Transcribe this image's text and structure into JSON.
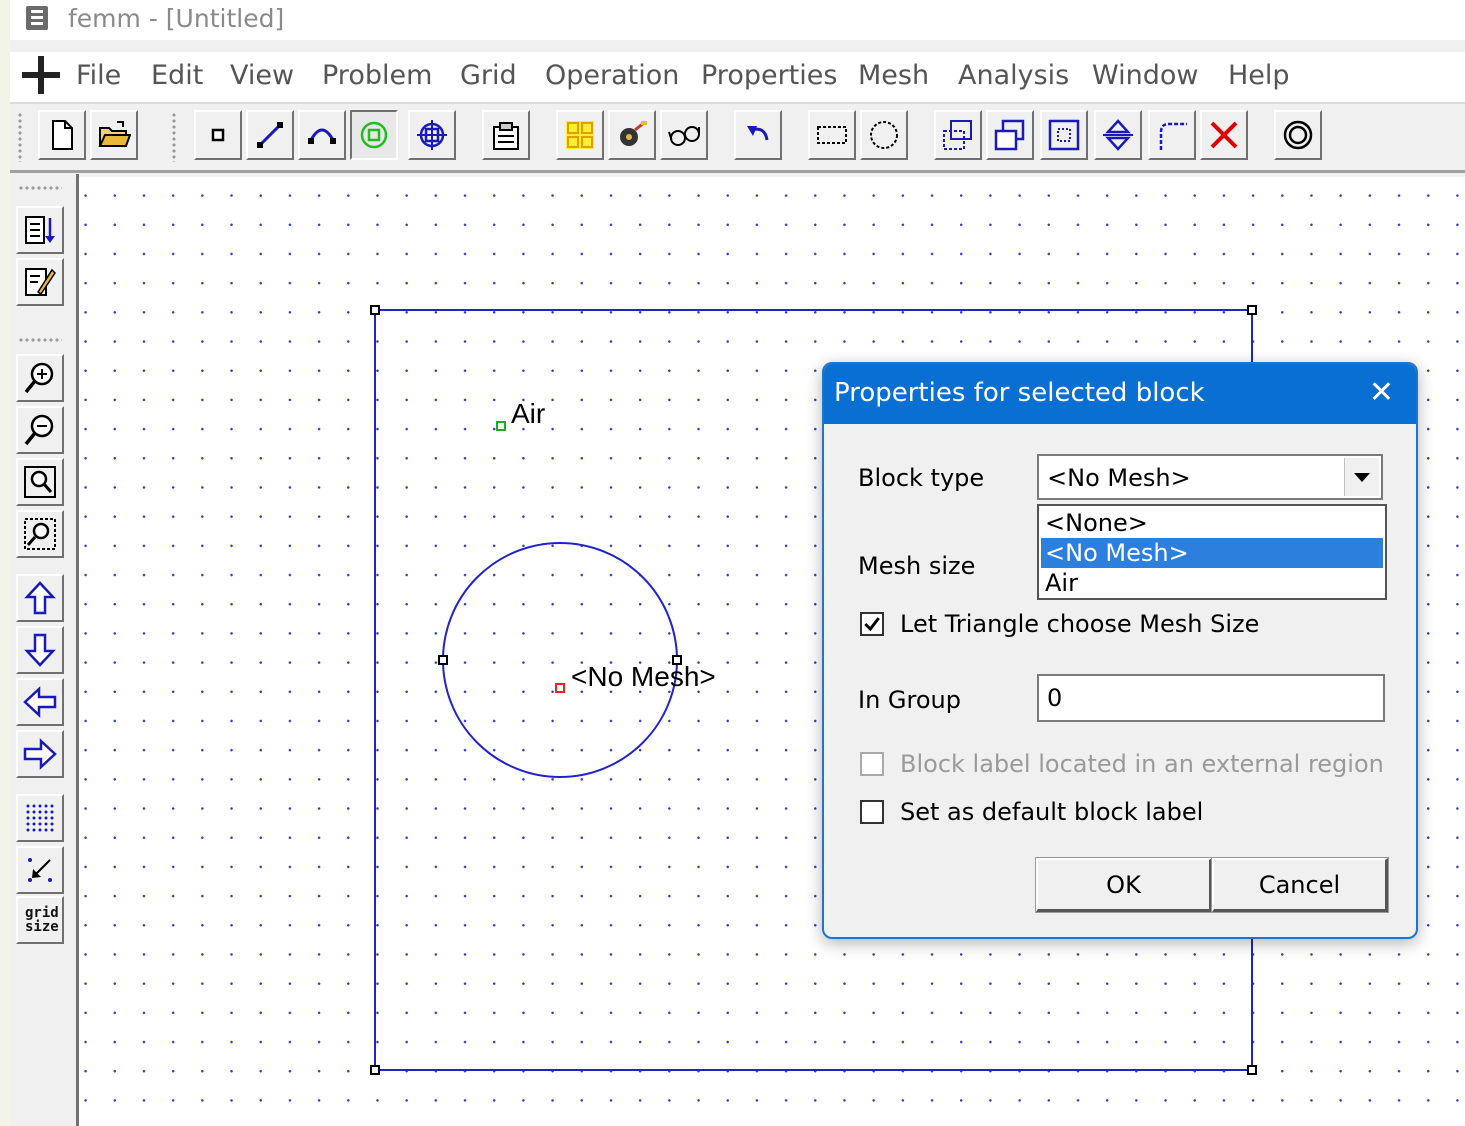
{
  "window": {
    "title": "femm - [Untitled]"
  },
  "menu": [
    "File",
    "Edit",
    "View",
    "Problem",
    "Grid",
    "Operation",
    "Properties",
    "Mesh",
    "Analysis",
    "Window",
    "Help"
  ],
  "left_toolbar": {
    "grid_size_label": "grid size"
  },
  "canvas": {
    "labels": {
      "air": "Air",
      "no_mesh": "<No Mesh>"
    }
  },
  "dialog": {
    "title": "Properties for selected block",
    "block_type_label": "Block type",
    "block_type_value": "<No Mesh>",
    "block_type_options": [
      "<None>",
      "<No Mesh>",
      "Air"
    ],
    "block_type_selected_index": 1,
    "mesh_size_label": "Mesh size",
    "let_triangle_label": "Let Triangle choose Mesh Size",
    "let_triangle_checked": true,
    "in_group_label": "In Group",
    "in_group_value": "0",
    "external_region_label": "Block label located in an external region",
    "external_region_checked": false,
    "default_label_label": "Set as default block label",
    "default_label_checked": false,
    "ok_label": "OK",
    "cancel_label": "Cancel"
  },
  "colors": {
    "dialog_accent": "#0a6fd3",
    "selection": "#2d7fde",
    "geometry": "#2222cc"
  }
}
